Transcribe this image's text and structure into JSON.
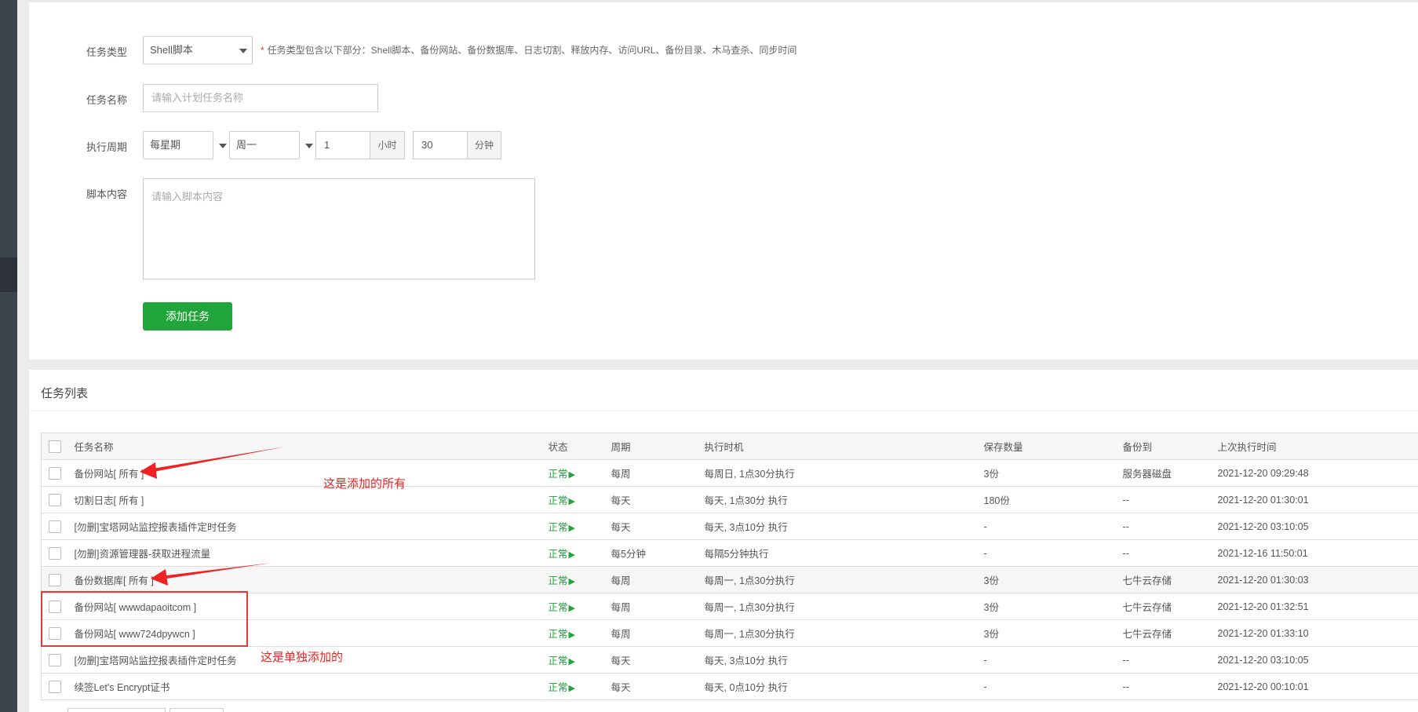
{
  "form": {
    "task_type_label": "任务类型",
    "task_type_value": "Shell脚本",
    "hint_star": "*",
    "hint": "任务类型包含以下部分：Shell脚本、备份网站、备份数据库、日志切割、释放内存、访问URL、备份目录、木马查杀、同步时间",
    "task_name_label": "任务名称",
    "task_name_placeholder": "请输入计划任务名称",
    "period_label": "执行周期",
    "period_type": "每星期",
    "weekday": "周一",
    "hour_value": "1",
    "hour_unit": "小时",
    "minute_value": "30",
    "minute_unit": "分钟",
    "script_label": "脚本内容",
    "script_placeholder": "请输入脚本内容",
    "add_button": "添加任务"
  },
  "list": {
    "title": "任务列表",
    "columns": [
      "任务名称",
      "状态",
      "周期",
      "执行时机",
      "保存数量",
      "备份到",
      "上次执行时间"
    ],
    "status_play_glyph": "▶",
    "rows": [
      {
        "name": "备份网站[ 所有 ]",
        "status": "正常",
        "cycle": "每周",
        "timing": "每周日, 1点30分执行",
        "keep": "3份",
        "backup_to": "服务器磁盘",
        "last_run": "2021-12-20 09:29:48"
      },
      {
        "name": "切割日志[ 所有 ]",
        "status": "正常",
        "cycle": "每天",
        "timing": "每天, 1点30分 执行",
        "keep": "180份",
        "backup_to": "--",
        "last_run": "2021-12-20 01:30:01"
      },
      {
        "name": "[勿删]宝塔网站监控报表插件定时任务",
        "status": "正常",
        "cycle": "每天",
        "timing": "每天, 3点10分 执行",
        "keep": "-",
        "backup_to": "--",
        "last_run": "2021-12-20 03:10:05"
      },
      {
        "name": "[勿删]资源管理器-获取进程流量",
        "status": "正常",
        "cycle": "每5分钟",
        "timing": "每隔5分钟执行",
        "keep": "-",
        "backup_to": "--",
        "last_run": "2021-12-16 11:50:01"
      },
      {
        "name": "备份数据库[ 所有 ]",
        "status": "正常",
        "cycle": "每周",
        "timing": "每周一, 1点30分执行",
        "keep": "3份",
        "backup_to": "七牛云存储",
        "last_run": "2021-12-20 01:30:03"
      },
      {
        "name": "备份网站[ wwwdapaoitcom ]",
        "status": "正常",
        "cycle": "每周",
        "timing": "每周一, 1点30分执行",
        "keep": "3份",
        "backup_to": "七牛云存储",
        "last_run": "2021-12-20 01:32:51"
      },
      {
        "name": "备份网站[ www724dpywcn ]",
        "status": "正常",
        "cycle": "每周",
        "timing": "每周一, 1点30分执行",
        "keep": "3份",
        "backup_to": "七牛云存储",
        "last_run": "2021-12-20 01:33:10"
      },
      {
        "name": "[勿删]宝塔网站监控报表插件定时任务",
        "status": "正常",
        "cycle": "每天",
        "timing": "每天, 3点10分 执行",
        "keep": "-",
        "backup_to": "--",
        "last_run": "2021-12-20 03:10:05"
      },
      {
        "name": "续签Let's Encrypt证书",
        "status": "正常",
        "cycle": "每天",
        "timing": "每天, 0点10分 执行",
        "keep": "-",
        "backup_to": "--",
        "last_run": "2021-12-20 00:10:01"
      }
    ]
  },
  "annotations": {
    "added_all": "这是添加的所有",
    "added_single": "这是单独添加的"
  },
  "colors": {
    "accent_green": "#20a53a",
    "annotation_red": "#ee2222",
    "sidebar": "#3c444d"
  }
}
